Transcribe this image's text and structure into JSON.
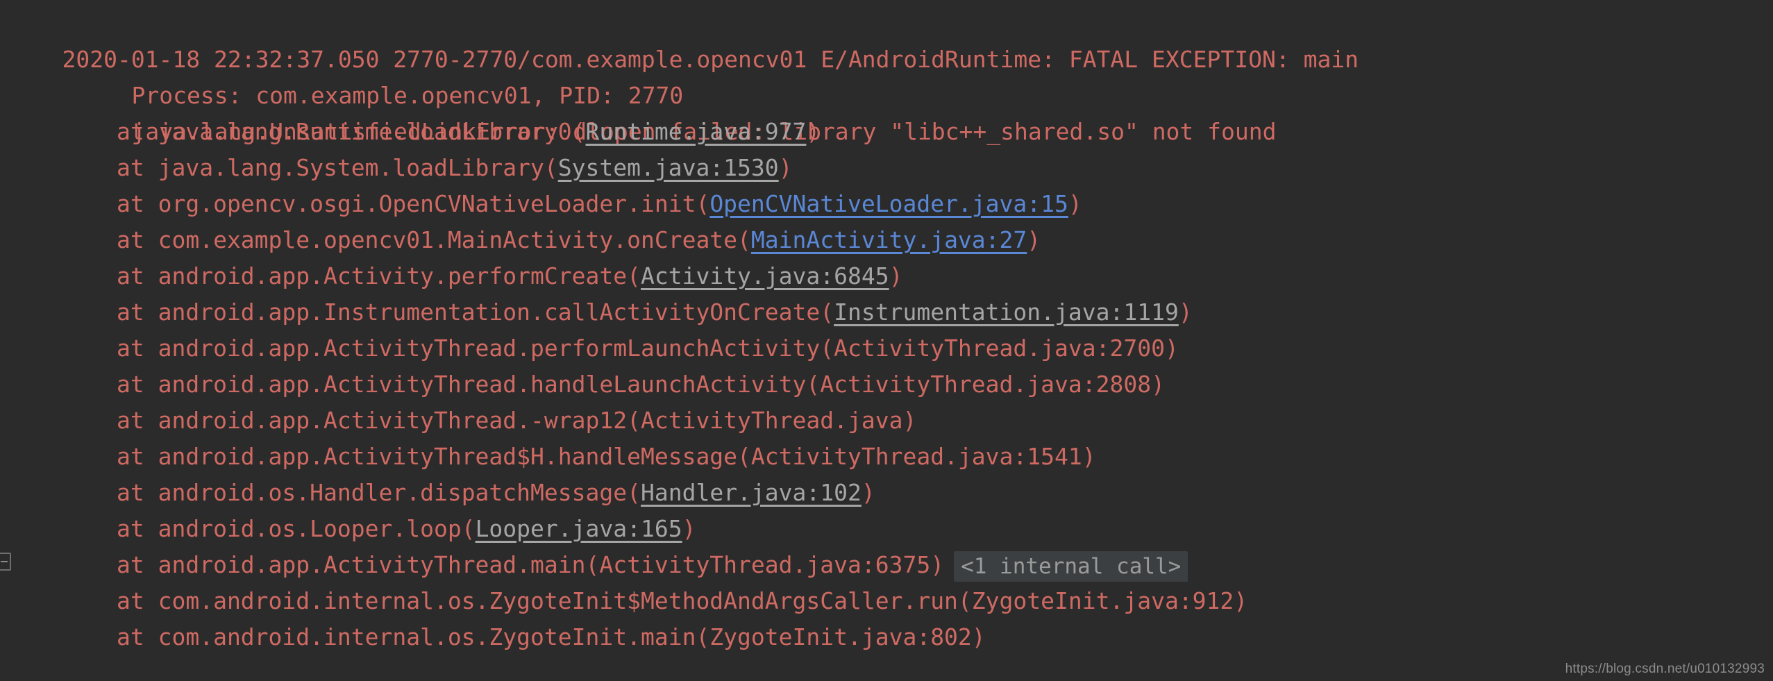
{
  "panel": {
    "name": "logcat-output",
    "background_color": "#2b2b2b",
    "text_color": "#cf6a63",
    "framework_link_color": "#a5a5a5",
    "project_link_color": "#5a87d6",
    "chip_background_color": "#3c3f41",
    "chip_text_color": "#9a9a9a"
  },
  "header": {
    "timestamp": "2020-01-18 22:32:37.050",
    "pid_tid": "2770-2770",
    "package": "com.example.opencv01",
    "level_tag": "E/AndroidRuntime:",
    "message": "FATAL EXCEPTION: main",
    "full": "2020-01-18 22:32:37.050 2770-2770/com.example.opencv01 E/AndroidRuntime: FATAL EXCEPTION: main"
  },
  "process_line": "Process: com.example.opencv01, PID: 2770",
  "exception_line": "java.lang.UnsatisfiedLinkError: dlopen failed: library \"libc++_shared.so\" not found",
  "stack_frames": [
    {
      "prefix": "at java.lang.Runtime.loadLibrary0(",
      "link": "Runtime.java:977",
      "link_type": "framework",
      "suffix": ")",
      "chip": ""
    },
    {
      "prefix": "at java.lang.System.loadLibrary(",
      "link": "System.java:1530",
      "link_type": "framework",
      "suffix": ")",
      "chip": ""
    },
    {
      "prefix": "at org.opencv.osgi.OpenCVNativeLoader.init(",
      "link": "OpenCVNativeLoader.java:15",
      "link_type": "project",
      "suffix": ")",
      "chip": ""
    },
    {
      "prefix": "at com.example.opencv01.MainActivity.onCreate(",
      "link": "MainActivity.java:27",
      "link_type": "project",
      "suffix": ")",
      "chip": ""
    },
    {
      "prefix": "at android.app.Activity.performCreate(",
      "link": "Activity.java:6845",
      "link_type": "framework",
      "suffix": ")",
      "chip": ""
    },
    {
      "prefix": "at android.app.Instrumentation.callActivityOnCreate(",
      "link": "Instrumentation.java:1119",
      "link_type": "framework",
      "suffix": ")",
      "chip": ""
    },
    {
      "prefix": "at android.app.ActivityThread.performLaunchActivity(ActivityThread.java:2700)",
      "link": "",
      "link_type": "none",
      "suffix": "",
      "chip": ""
    },
    {
      "prefix": "at android.app.ActivityThread.handleLaunchActivity(ActivityThread.java:2808)",
      "link": "",
      "link_type": "none",
      "suffix": "",
      "chip": ""
    },
    {
      "prefix": "at android.app.ActivityThread.-wrap12(ActivityThread.java)",
      "link": "",
      "link_type": "none",
      "suffix": "",
      "chip": ""
    },
    {
      "prefix": "at android.app.ActivityThread$H.handleMessage(ActivityThread.java:1541)",
      "link": "",
      "link_type": "none",
      "suffix": "",
      "chip": ""
    },
    {
      "prefix": "at android.os.Handler.dispatchMessage(",
      "link": "Handler.java:102",
      "link_type": "framework",
      "suffix": ")",
      "chip": ""
    },
    {
      "prefix": "at android.os.Looper.loop(",
      "link": "Looper.java:165",
      "link_type": "framework",
      "suffix": ")",
      "chip": ""
    },
    {
      "prefix": "at android.app.ActivityThread.main(ActivityThread.java:6375)",
      "link": "",
      "link_type": "none",
      "suffix": "",
      "chip": "<1 internal call>"
    },
    {
      "prefix": "at com.android.internal.os.ZygoteInit$MethodAndArgsCaller.run(ZygoteInit.java:912)",
      "link": "",
      "link_type": "none",
      "suffix": "",
      "chip": ""
    },
    {
      "prefix": "at com.android.internal.os.ZygoteInit.main(ZygoteInit.java:802)",
      "link": "",
      "link_type": "none",
      "suffix": "",
      "chip": ""
    }
  ],
  "gutter": {
    "fold_marker_icon": "fold-collapse-icon"
  },
  "watermark": "https://blog.csdn.net/u010132993"
}
